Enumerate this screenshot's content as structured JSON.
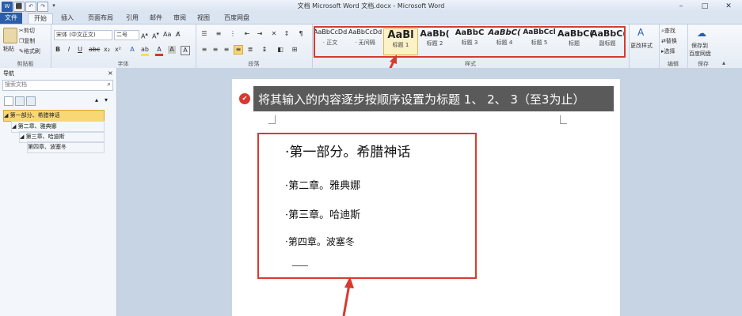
{
  "window": {
    "title": "文档 Microsoft Word 文档.docx - Microsoft Word"
  },
  "quick_access": {
    "word_icon": "W",
    "save": "⬛",
    "undo": "↶",
    "redo": "↷",
    "customize": "▾"
  },
  "window_controls": {
    "minimize": "–",
    "maximize": "□",
    "close": "✕"
  },
  "tabs": [
    "文件",
    "开始",
    "插入",
    "页面布局",
    "引用",
    "邮件",
    "审阅",
    "视图",
    "百度网盘"
  ],
  "clipboard": {
    "paste": "粘贴",
    "cut": "剪切",
    "copy": "复制",
    "format_painter": "格式刷",
    "group": "剪贴板"
  },
  "font": {
    "family": "宋体 (中文正文)",
    "size": "二号",
    "group": "字体"
  },
  "paragraph": {
    "group": "段落"
  },
  "styles": {
    "group": "样式",
    "items": [
      {
        "sample": "AaBbCcDd",
        "label": "· 正文"
      },
      {
        "sample": "AaBbCcDd",
        "label": "· 无间隔"
      },
      {
        "sample": "AaBl",
        "label": "标题 1"
      },
      {
        "sample": "AaBb(",
        "label": "标题 2"
      },
      {
        "sample": "AaBbC",
        "label": "标题 3"
      },
      {
        "sample": "AaBbC(",
        "label": "标题 4"
      },
      {
        "sample": "AaBbCcl",
        "label": "标题 5"
      },
      {
        "sample": "AaBbC(",
        "label": "标题"
      },
      {
        "sample": "AaBbC(",
        "label": "副标题"
      }
    ],
    "change_styles": "更改样式"
  },
  "editing": {
    "find": "查找",
    "replace": "替换",
    "select": "选择",
    "group": "编辑"
  },
  "save_group": {
    "label1": "保存到",
    "label2": "百度网盘",
    "group": "保存"
  },
  "nav": {
    "title": "导航",
    "search_placeholder": "搜索文档",
    "items": [
      "第一部分、希腊神话",
      "第二章、雅典娜",
      "第三章、哈迪斯",
      "第四章、波塞冬"
    ]
  },
  "annotation": {
    "badge": "✔",
    "text": "将其输入的内容逐步按顺序设置为标题 1、 2、 3（至3为止）"
  },
  "document": {
    "headings": [
      "第一部分。希腊神话",
      "第二章。雅典娜",
      "第三章。哈迪斯",
      "第四章。波塞冬"
    ]
  },
  "colors": {
    "highlight": "#d83a2f",
    "annotation_bg": "#5a5a5a",
    "accent": "#2a5ea8"
  }
}
